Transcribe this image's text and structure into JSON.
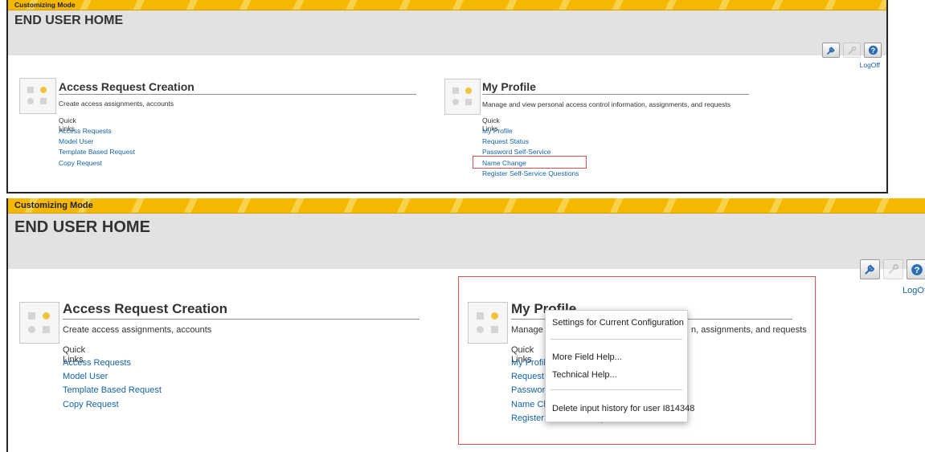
{
  "top": {
    "mode_label": "Customizing Mode",
    "page_title": "END USER HOME",
    "logoff": "LogOff",
    "tiles": [
      {
        "title": "Access Request Creation",
        "desc": "Create access assignments, accounts",
        "quick_links_label": "Quick Links",
        "links": [
          "Access Requests",
          "Model User",
          "Template Based Request",
          "Copy Request"
        ]
      },
      {
        "title": "My Profile",
        "desc": "Manage and view personal access control information, assignments, and requests",
        "quick_links_label": "Quick Links",
        "links": [
          "My Profile",
          "Request Status",
          "Password Self-Service",
          "Name Change",
          "Register Self-Service Questions"
        ]
      }
    ]
  },
  "bottom": {
    "mode_label": "Customizing Mode",
    "page_title": "END USER HOME",
    "logoff": "LogOf",
    "tiles": [
      {
        "title": "Access Request Creation",
        "desc": "Create access assignments, accounts",
        "quick_links_label": "Quick Links",
        "links": [
          "Access Requests",
          "Model User",
          "Template Based Request",
          "Copy Request"
        ]
      },
      {
        "title": "My Profile",
        "desc_left": "Manage and",
        "desc_right": "n, assignments, and requests",
        "quick_links_label": "Quick Links",
        "links": [
          "My Profile",
          "Request Sta",
          "Password S",
          "Name Chan",
          "Register Self-Service Questions"
        ]
      }
    ],
    "context_menu": {
      "items": [
        "Settings for Current Configuration",
        "More Field Help...",
        "Technical Help...",
        "Delete input history for user I814348"
      ]
    }
  },
  "icons": {
    "toolbar": [
      "wrench-icon",
      "key-icon",
      "help-icon"
    ],
    "tile": "tile-grid-icon"
  },
  "colors": {
    "accent_yellow": "#f4b800",
    "link_blue": "#1464a5",
    "highlight_red": "#d9534f",
    "header_gray": "#e2e2e2"
  }
}
